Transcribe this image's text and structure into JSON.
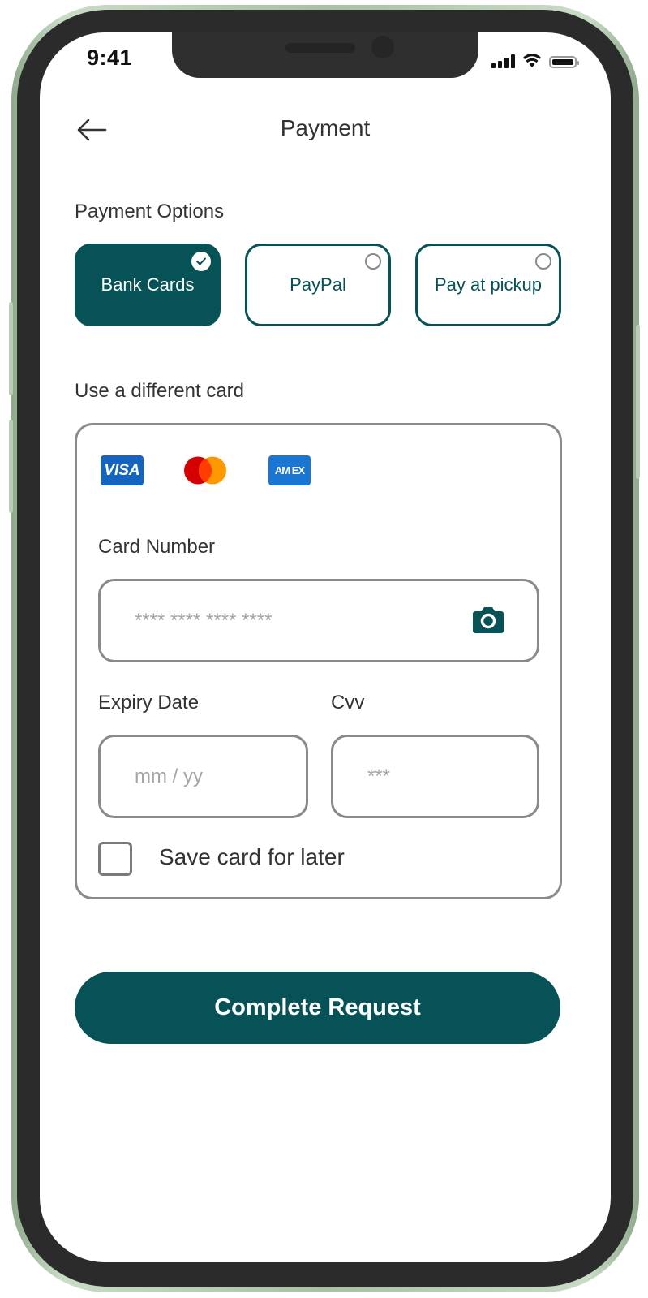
{
  "status_bar": {
    "time": "9:41",
    "icons": [
      "signal-icon",
      "wifi-icon",
      "battery-icon"
    ]
  },
  "header": {
    "title": "Payment",
    "back_icon": "arrow-left-icon"
  },
  "payment_options": {
    "label": "Payment Options",
    "options": [
      {
        "label": "Bank Cards",
        "selected": true
      },
      {
        "label": "PayPal",
        "selected": false
      },
      {
        "label": "Pay at pickup",
        "selected": false
      }
    ]
  },
  "card_section": {
    "label": "Use a different card",
    "brands": [
      "VISA",
      "Mastercard",
      "AMEX"
    ],
    "visa_text": "VISA",
    "amex_text": "AM EX",
    "card_number": {
      "label": "Card Number",
      "placeholder": "**** **** **** ****",
      "value": ""
    },
    "expiry": {
      "label": "Expiry Date",
      "placeholder": "mm / yy",
      "value": ""
    },
    "cvv": {
      "label": "Cvv",
      "placeholder": "***",
      "value": ""
    },
    "save_card": {
      "label": "Save card for later",
      "checked": false
    }
  },
  "submit": {
    "label": "Complete Request"
  },
  "colors": {
    "primary": "#075257",
    "border": "#8a8a8a",
    "frame": "#b9cdb5"
  }
}
